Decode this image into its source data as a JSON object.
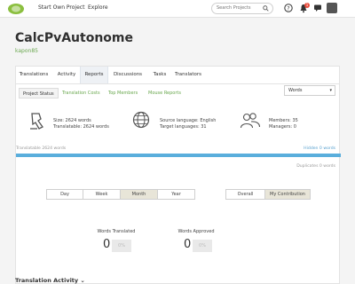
{
  "nav": {
    "start_project": "Start Own Project",
    "explore": "Explore",
    "search_placeholder": "Search Projects",
    "notification_count": "1"
  },
  "project": {
    "title": "CalcPvAutonome",
    "owner": "kapon85"
  },
  "tabs": {
    "translations": "Translations",
    "activity": "Activity",
    "reports": "Reports",
    "discussions": "Discussions",
    "tasks": "Tasks",
    "translators": "Translators"
  },
  "subtabs": {
    "project_status": "Project Status",
    "translation_costs": "Translation Costs",
    "top_members": "Top Members",
    "mouse_reports": "Mouse Reports"
  },
  "unit_select": {
    "value": "Words"
  },
  "stats": {
    "size": "Size: 2624 words",
    "translatable": "Translatable: 2624 words",
    "source_language": "Source language: English",
    "target_languages": "Target languages: 31",
    "members": "Members: 35",
    "managers": "Managers: 0"
  },
  "progress": {
    "left_label": "Translatable 2624 words",
    "right_label": "Hidden 0 words",
    "below_label": "Duplicates 0 words",
    "fraction": 1.0
  },
  "periods": {
    "day": "Day",
    "week": "Week",
    "month": "Month",
    "year": "Year",
    "selected": "Month"
  },
  "scope": {
    "overall": "Overall",
    "my_contribution": "My Contribution",
    "selected": "My Contribution"
  },
  "metrics": {
    "words_translated_label": "Words Translated",
    "words_translated_value": "0",
    "words_translated_pct": "0%",
    "words_approved_label": "Words Approved",
    "words_approved_value": "0",
    "words_approved_pct": "0%"
  },
  "section": {
    "translation_activity": "Translation Activity"
  },
  "colors": {
    "accent_green": "#6aa84f",
    "progress_blue": "#5aaedc",
    "active_segment": "#e8e5d8"
  }
}
